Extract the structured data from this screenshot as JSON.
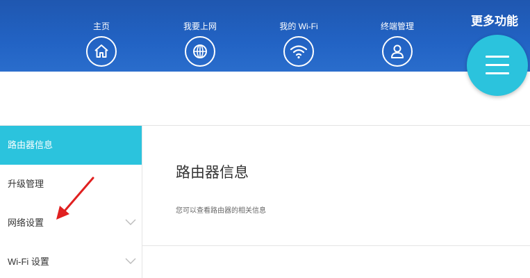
{
  "topnav": {
    "items": [
      {
        "label": "主页",
        "icon": "home-icon"
      },
      {
        "label": "我要上网",
        "icon": "globe-icon"
      },
      {
        "label": "我的 Wi-Fi",
        "icon": "wifi-icon"
      },
      {
        "label": "终端管理",
        "icon": "user-icon"
      }
    ],
    "more_label": "更多功能",
    "more_icon": "menu-icon"
  },
  "sidebar": {
    "items": [
      {
        "label": "路由器信息",
        "active": true
      },
      {
        "label": "升级管理",
        "active": false
      },
      {
        "label": "网络设置",
        "active": false,
        "expandable": true
      },
      {
        "label": "Wi-Fi 设置",
        "active": false,
        "expandable": true
      }
    ]
  },
  "content": {
    "title": "路由器信息",
    "description": "您可以查看路由器的相关信息"
  },
  "colors": {
    "header_blue": "#2263c4",
    "accent_cyan": "#2bc3dd",
    "annotation_red": "#e02020"
  }
}
